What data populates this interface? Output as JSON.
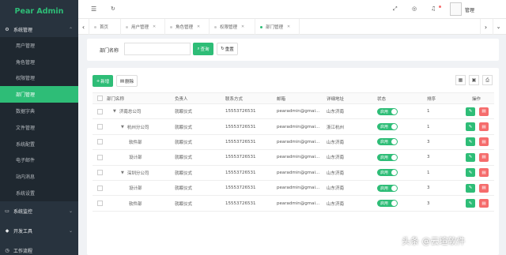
{
  "app": {
    "title": "Pear Admin"
  },
  "sidebar": {
    "system_group": "系统管理",
    "items": [
      {
        "label": "用户管理"
      },
      {
        "label": "角色管理"
      },
      {
        "label": "权限管理"
      },
      {
        "label": "部门管理",
        "active": true
      },
      {
        "label": "数据字典"
      },
      {
        "label": "文件管理"
      },
      {
        "label": "系统配置"
      },
      {
        "label": "电子邮件"
      },
      {
        "label": "站内消息"
      },
      {
        "label": "系统设置"
      }
    ],
    "groups_bottom": [
      {
        "label": "系统监控"
      },
      {
        "label": "开发工具"
      },
      {
        "label": "工作流程"
      }
    ]
  },
  "topbar": {
    "user": "管理"
  },
  "tabs": [
    {
      "label": "首页"
    },
    {
      "label": "用户管理"
    },
    {
      "label": "角色管理"
    },
    {
      "label": "权限管理"
    },
    {
      "label": "部门管理",
      "active": true
    }
  ],
  "search": {
    "label": "部门名称",
    "query_label": "查询",
    "reset_label": "重置"
  },
  "toolbar": {
    "add_label": "新增",
    "delete_label": "删除"
  },
  "table": {
    "headers": [
      "部门名称",
      "负责人",
      "联系方式",
      "邮箱",
      "详细地址",
      "状态",
      "排序",
      "操作"
    ],
    "rows": [
      {
        "name": "济南总公司",
        "level": 0,
        "expanded": true,
        "leader": "就眠仪式",
        "phone": "15553726531",
        "email": "pearadmin@gmai...",
        "address": "山东济南",
        "status": "启用",
        "sort": "1"
      },
      {
        "name": "杭州分公司",
        "level": 1,
        "expanded": true,
        "leader": "就眠仪式",
        "phone": "15553726531",
        "email": "pearadmin@gmai...",
        "address": "浙江杭州",
        "status": "启用",
        "sort": "1"
      },
      {
        "name": "软件部",
        "level": 2,
        "leader": "就眠仪式",
        "phone": "15553726531",
        "email": "pearadmin@gmai...",
        "address": "山东济南",
        "status": "启用",
        "sort": "3"
      },
      {
        "name": "设计部",
        "level": 2,
        "leader": "就眠仪式",
        "phone": "15553726531",
        "email": "pearadmin@gmai...",
        "address": "山东济南",
        "status": "启用",
        "sort": "3"
      },
      {
        "name": "深圳分公司",
        "level": 1,
        "expanded": true,
        "leader": "就眠仪式",
        "phone": "15553726531",
        "email": "pearadmin@gmai...",
        "address": "山东济南",
        "status": "启用",
        "sort": "1"
      },
      {
        "name": "设计部",
        "level": 2,
        "leader": "就眠仪式",
        "phone": "15553726531",
        "email": "pearadmin@gmai...",
        "address": "山东济南",
        "status": "启用",
        "sort": "3"
      },
      {
        "name": "软件部",
        "level": 2,
        "leader": "就眠仪式",
        "phone": "15553726531",
        "email": "pearadmin@gmai...",
        "address": "山东济南",
        "status": "启用",
        "sort": "3"
      }
    ]
  },
  "watermark": "头条 @云瑄软件",
  "colors": {
    "accent": "#2ebd77",
    "danger": "#f56c6c",
    "sidebar": "#28333e"
  }
}
